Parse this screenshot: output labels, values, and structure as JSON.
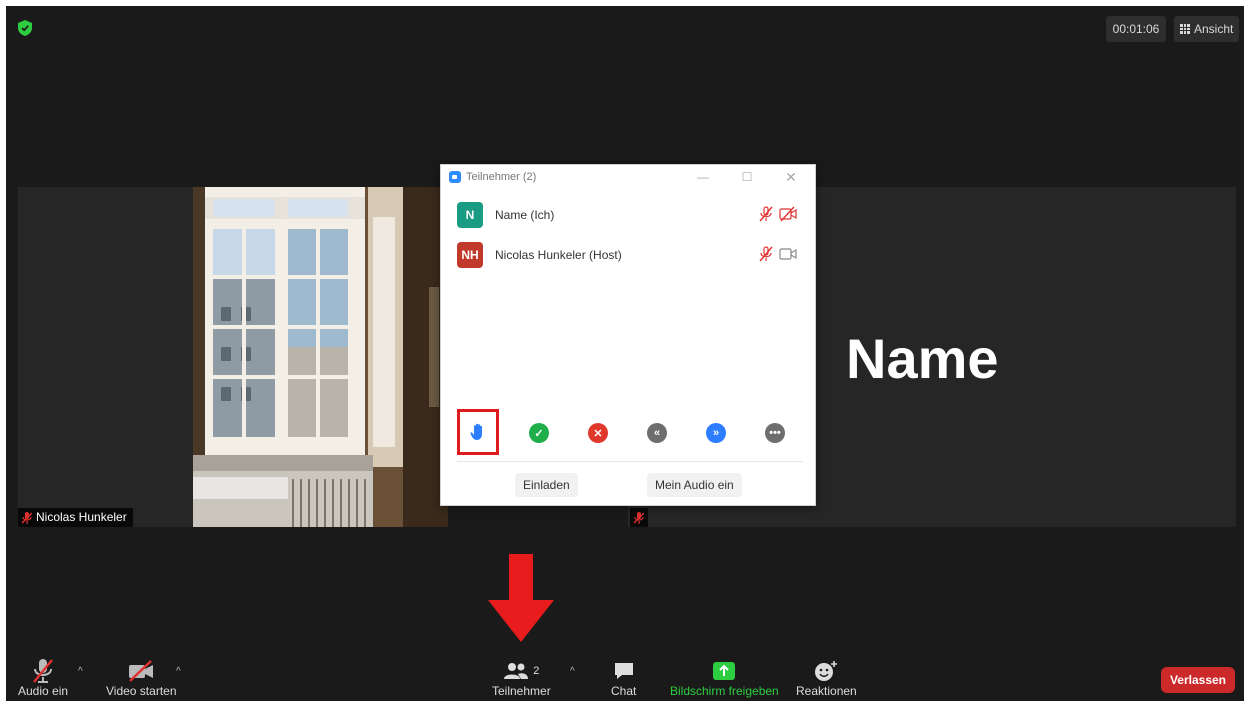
{
  "top_bar": {
    "timer": "00:01:06",
    "view_label": "Ansicht"
  },
  "video": {
    "left_tile_name": "Nicolas Hunkeler",
    "right_tile_big_name": "Name"
  },
  "participants_panel": {
    "title": "Teilnehmer (2)",
    "participants": [
      {
        "initials": "N",
        "name": "Name (Ich)",
        "avatar_color": "#1a9b83",
        "mic_muted": true,
        "video_off": true
      },
      {
        "initials": "NH",
        "name": "Nicolas Hunkeler (Host)",
        "avatar_color": "#c0392b",
        "mic_muted": true,
        "video_off": false
      }
    ],
    "invite_label": "Einladen",
    "audio_label": "Mein Audio ein"
  },
  "toolbar": {
    "audio_label": "Audio ein",
    "video_label": "Video starten",
    "participants_label": "Teilnehmer",
    "participants_count": "2",
    "chat_label": "Chat",
    "share_label": "Bildschirm freigeben",
    "reactions_label": "Reaktionen",
    "leave_label": "Verlassen"
  },
  "colors": {
    "accent_green": "#2ecc40",
    "leave_red": "#cc2a2a",
    "highlight_red": "#e01b1b",
    "raise_hand_blue": "#2d7dff"
  }
}
